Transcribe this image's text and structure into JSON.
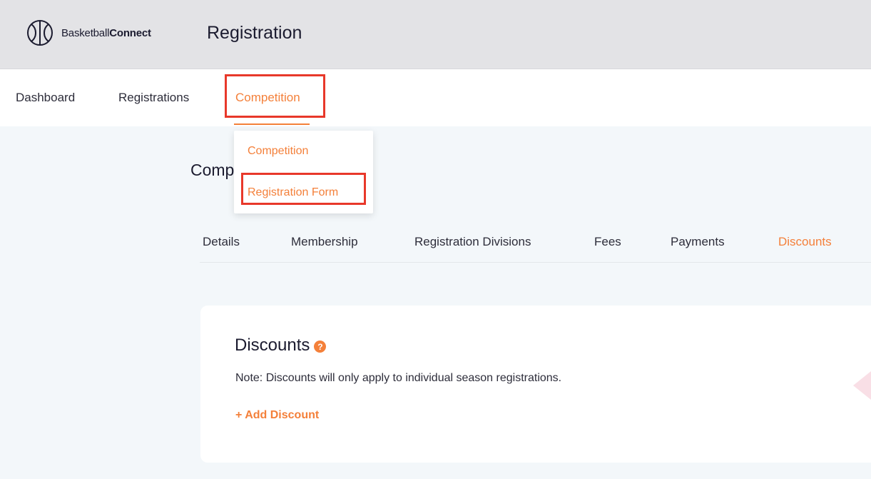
{
  "header": {
    "logo_text_thin": "Basketball",
    "logo_text_bold": "Connect",
    "title": "Registration"
  },
  "nav": {
    "items": [
      {
        "label": "Dashboard"
      },
      {
        "label": "Registrations"
      },
      {
        "label": "Competition",
        "active": true
      }
    ]
  },
  "dropdown": {
    "items": [
      {
        "label": "Competition"
      },
      {
        "label": "Registration Form"
      }
    ]
  },
  "page": {
    "heading": "Comp"
  },
  "tabs": {
    "items": [
      {
        "label": "Details"
      },
      {
        "label": "Membership"
      },
      {
        "label": "Registration Divisions"
      },
      {
        "label": "Fees"
      },
      {
        "label": "Payments"
      },
      {
        "label": "Discounts",
        "active": true
      }
    ]
  },
  "card": {
    "title": "Discounts",
    "help_icon": "?",
    "note": "Note: Discounts will only apply to individual season registrations.",
    "add_label": "+ Add Discount"
  },
  "colors": {
    "accent": "#f4803a",
    "highlight": "#e8382a",
    "header_bg": "#e3e3e6",
    "page_bg": "#f3f7fa"
  },
  "icons": {
    "logo": "basketball-icon",
    "help": "question-circle-icon"
  }
}
